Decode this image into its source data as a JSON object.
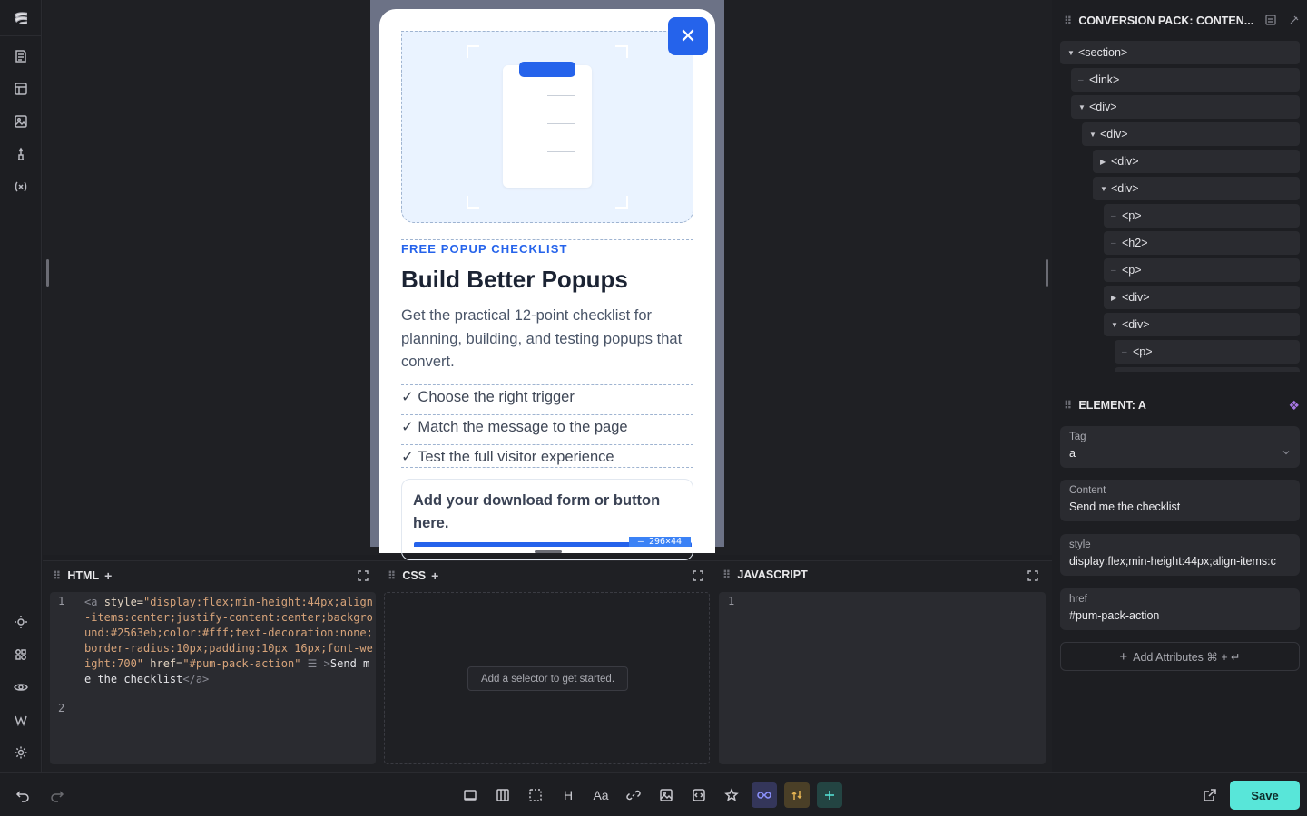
{
  "popup": {
    "eyebrow": "FREE POPUP CHECKLIST",
    "title": "Build Better Popups",
    "description": "Get the practical 12-point checklist for planning, building, and testing popups that convert.",
    "checklist": [
      "✓ Choose the right trigger",
      "✓ Match the message to the page",
      "✓ Test the full visitor experience"
    ],
    "placeholder": "Add your download form or button here.",
    "selection_badge": "— 296×44",
    "close_glyph": "✕"
  },
  "structure_panel": {
    "title": "CONVERSION PACK: CONTEN...",
    "nodes": [
      "<section>",
      "<link>",
      "<div>",
      "<div>",
      "<div>",
      "<div>",
      "<p>",
      "<h2>",
      "<p>",
      "<div>",
      "<div>",
      "<p>"
    ]
  },
  "element_panel": {
    "title": "ELEMENT: A",
    "tag_label": "Tag",
    "tag_value": "a",
    "content_label": "Content",
    "content_value": "Send me the checklist",
    "style_label": "style",
    "style_value": "display:flex;min-height:44px;align-items:c",
    "href_label": "href",
    "href_value": "#pum-pack-action",
    "add_attributes": "Add Attributes ⌘ + ↵"
  },
  "editors": {
    "html_title": "HTML",
    "css_title": "CSS",
    "js_title": "JAVASCRIPT",
    "css_hint": "Add a selector to get started.",
    "html_line1": "1",
    "html_line2": "2",
    "js_line1": "1",
    "code_open": "<a ",
    "code_style_attr": "style=",
    "code_style_val": "\"display:flex;min-height:44px;align-items:center;justify-content:center;background:#2563eb;color:#fff;text-decoration:none;border-radius:10px;padding:10px 16px;font-weight:700\"",
    "code_href_attr": " href=",
    "code_href_val": "\"#pum-pack-action\"",
    "code_gt": ">",
    "code_text": "Send me the checklist",
    "code_close": "</a>"
  },
  "toolbar": {
    "heading_glyph": "H",
    "text_glyph": "Aa",
    "save_label": "Save"
  },
  "colors": {
    "accent": "#2563eb",
    "save": "#58e6d9",
    "badge": "#3b82f6"
  }
}
